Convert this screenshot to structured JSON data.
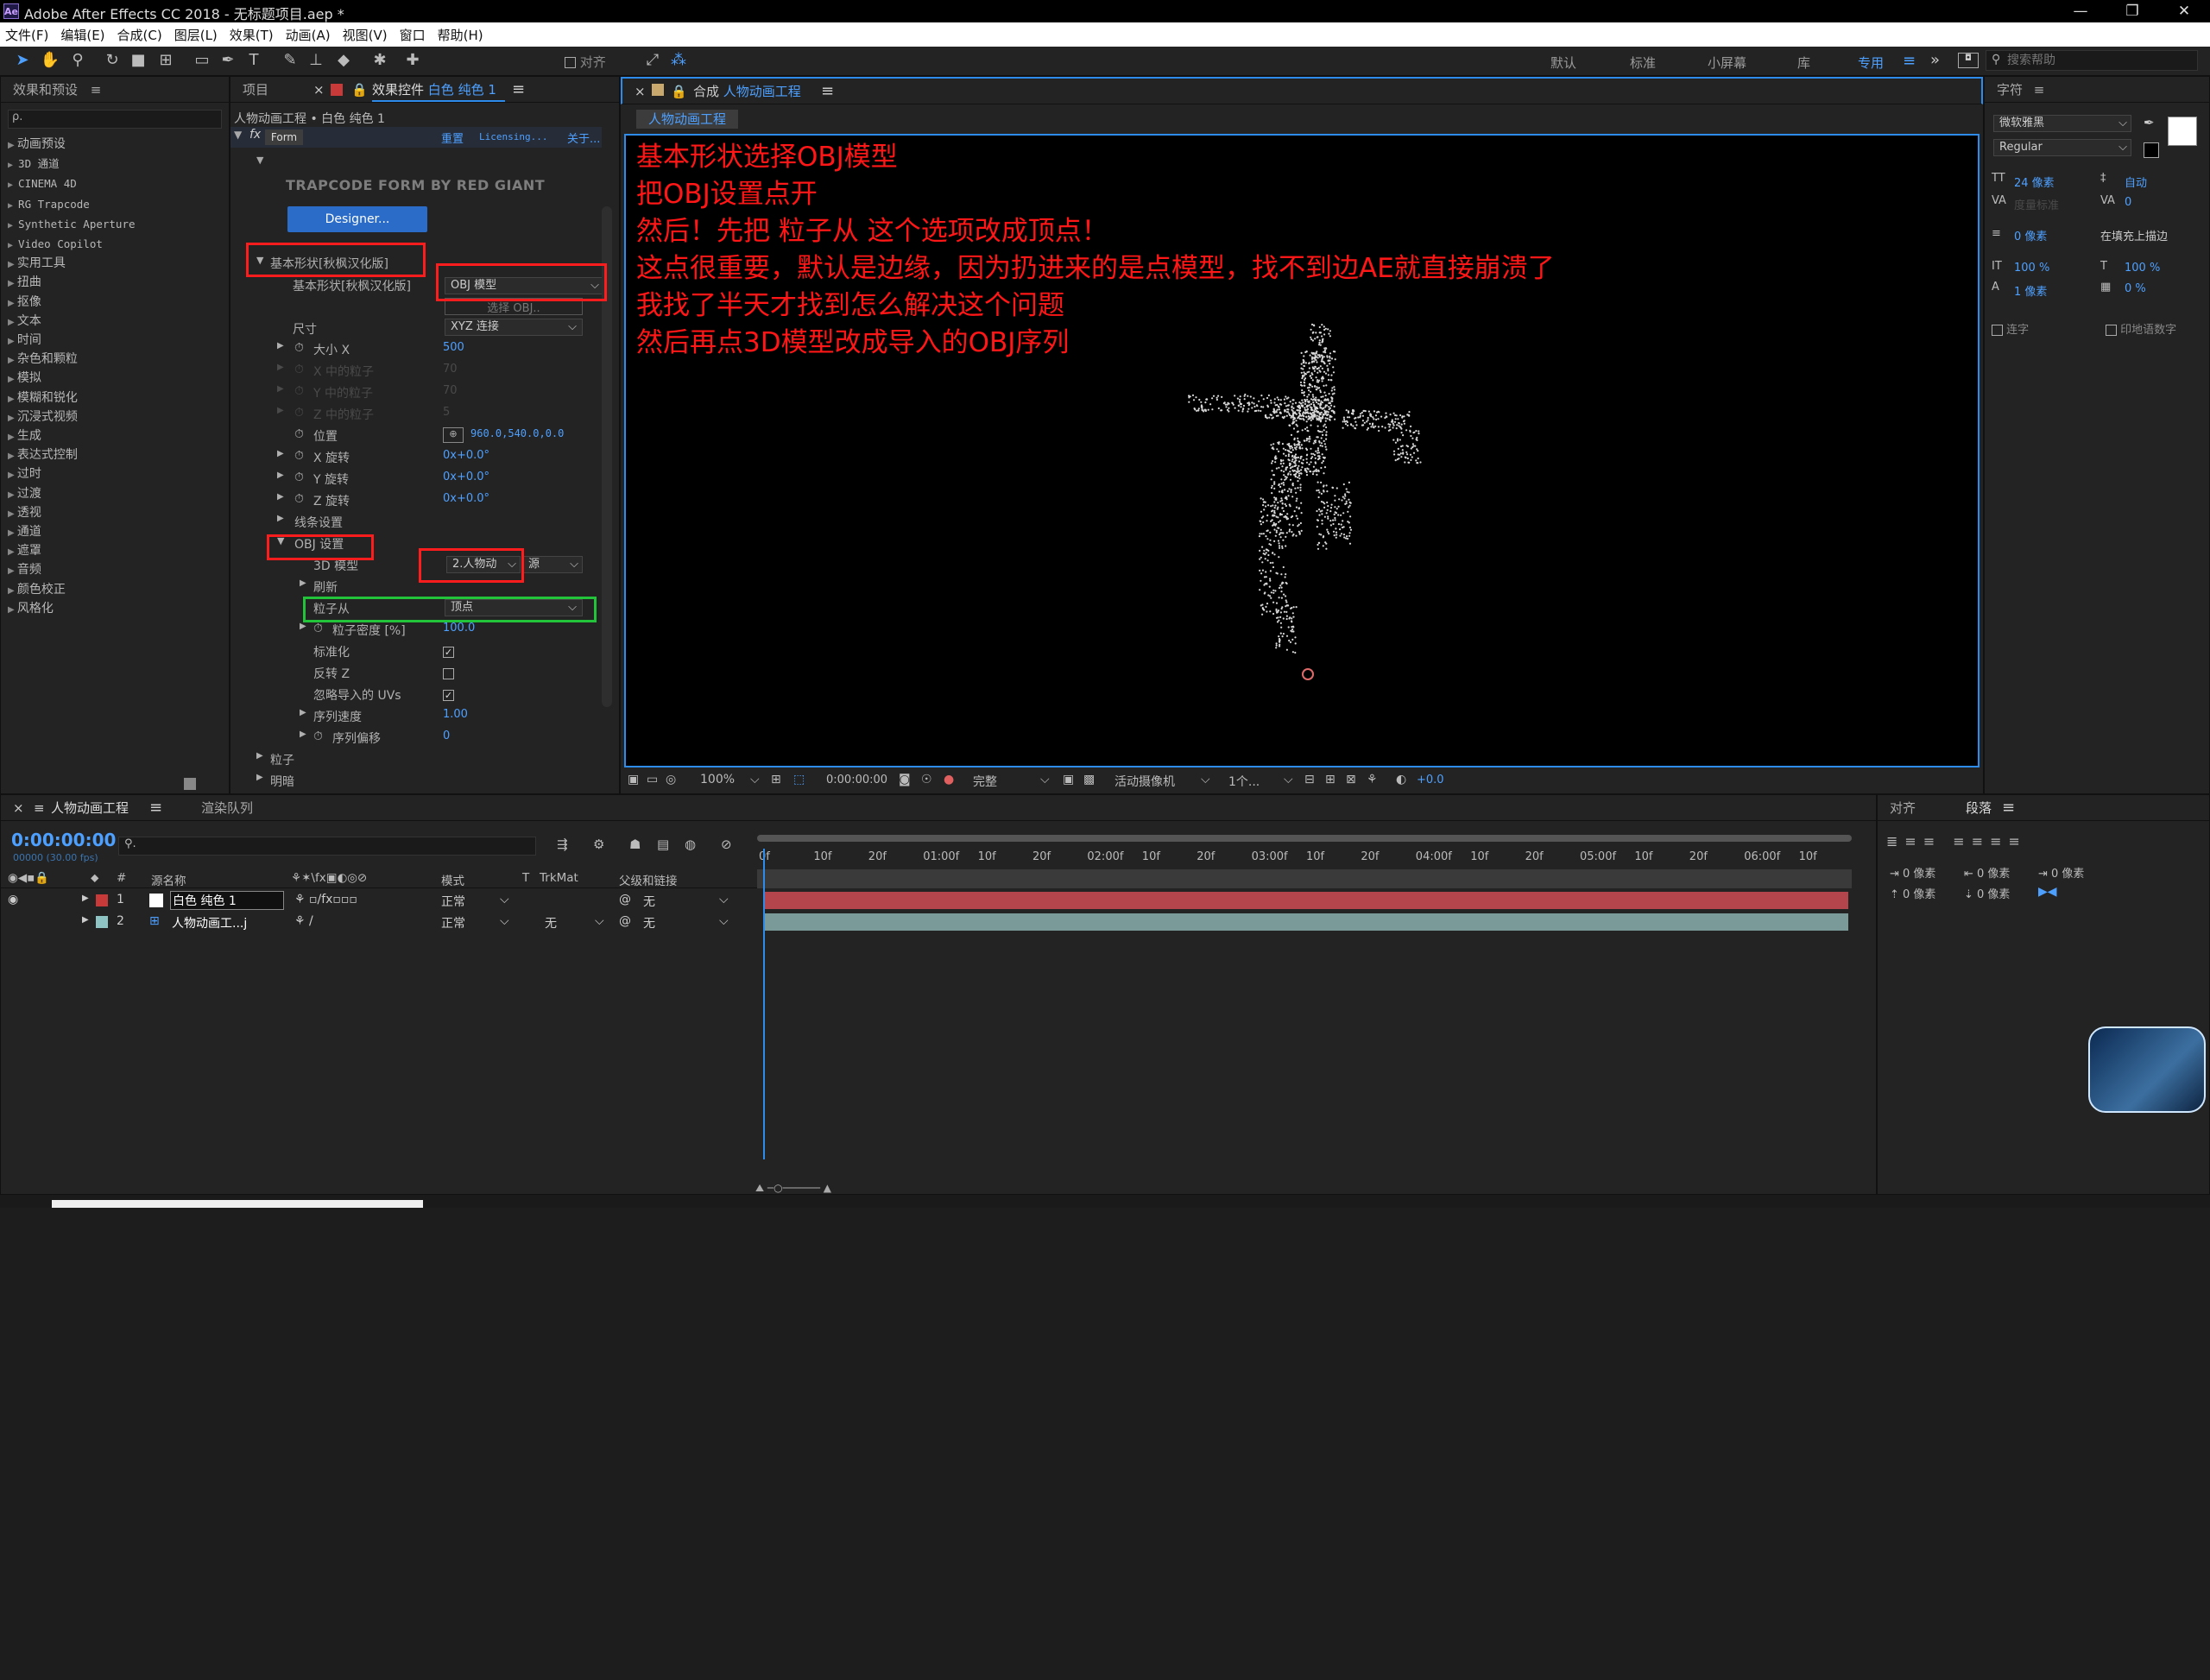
{
  "app": {
    "title": "Adobe After Effects CC 2018 - 无标题项目.aep *",
    "icon": "Ae"
  },
  "menu": [
    "文件(F)",
    "编辑(E)",
    "合成(C)",
    "图层(L)",
    "效果(T)",
    "动画(A)",
    "视图(V)",
    "窗口",
    "帮助(H)"
  ],
  "toolbar": {
    "align_label": "对齐",
    "workspaces": [
      "默认",
      "标准",
      "小屏幕",
      "库",
      "专用"
    ],
    "search_placeholder": "搜索帮助"
  },
  "effects_panel": {
    "title": "效果和预设",
    "search": "ρ.",
    "items": [
      "动画预设",
      "3D 通道",
      "CINEMA 4D",
      "RG Trapcode",
      "Synthetic Aperture",
      "Video Copilot",
      "实用工具",
      "扭曲",
      "抠像",
      "文本",
      "时间",
      "杂色和颗粒",
      "模拟",
      "模糊和锐化",
      "沉浸式视频",
      "生成",
      "表达式控制",
      "过时",
      "过渡",
      "透视",
      "通道",
      "遮罩",
      "音频",
      "颜色校正",
      "风格化"
    ]
  },
  "effect_controls": {
    "tab_project": "项目",
    "tab_effect": "效果控件",
    "layer_name": "白色 纯色 1",
    "breadcrumb": "人物动画工程 • 白色 纯色 1",
    "fx_name": "Form",
    "reset": "重置",
    "licensing": "Licensing...",
    "about": "关于...",
    "brand": "TRAPCODE FORM BY RED GIANT",
    "designer": "Designer...",
    "base_form_group": "基本形状[秋枫汉化版]",
    "base_form_label": "基本形状[秋枫汉化版]",
    "base_form_value": "OBJ 模型",
    "select_obj": "选择 OBJ..",
    "size_label": "尺寸",
    "size_value": "XYZ 连接",
    "rows": [
      {
        "label": "大小 X",
        "value": "500",
        "dim": false
      },
      {
        "label": "X 中的粒子",
        "value": "70",
        "dim": true
      },
      {
        "label": "Y 中的粒子",
        "value": "70",
        "dim": true
      },
      {
        "label": "Z 中的粒子",
        "value": "5",
        "dim": true
      }
    ],
    "position_label": "位置",
    "position_value": "960.0,540.0,0.0",
    "rot_x": "X 旋转",
    "rot_y": "Y 旋转",
    "rot_z": "Z 旋转",
    "rot_value": "0x+0.0°",
    "string_settings": "线条设置",
    "obj_settings": "OBJ 设置",
    "model_label": "3D 模型",
    "model_value": "2.人物动",
    "source_value": "源",
    "refresh": "刷新",
    "particles_from": "粒子从",
    "particles_from_value": "顶点",
    "density_label": "粒子密度 [%]",
    "density_value": "100.0",
    "normalize": "标准化",
    "invert_z": "反转 Z",
    "ignore_uvs": "忽略导入的 UVs",
    "seq_speed": "序列速度",
    "seq_speed_value": "1.00",
    "seq_offset": "序列偏移",
    "seq_offset_value": "0",
    "particle": "粒子",
    "shading": "明暗"
  },
  "viewer": {
    "tab_prefix": "合成",
    "comp_name": "人物动画工程",
    "sub_tab": "人物动画工程",
    "annotations": [
      "基本形状选择OBJ模型",
      "把OBJ设置点开",
      "然后！先把  粒子从  这个选项改成顶点！",
      "这点很重要，默认是边缘，因为扔进来的是点模型，找不到边AE就直接崩溃了",
      "我找了半天才找到怎么解决这个问题",
      "然后再点3D模型改成导入的OBJ序列"
    ],
    "zoom": "100%",
    "time": "0:00:00:00",
    "quality": "完整",
    "camera": "活动摄像机",
    "views": "1个...",
    "exposure": "+0.0"
  },
  "character_panel": {
    "title": "字符",
    "font": "微软雅黑",
    "style": "Regular",
    "size": "24 像素",
    "leading": "自动",
    "kerning": "度量标准",
    "tracking": "0",
    "stroke": "0 像素",
    "stroke_mode": "在填充上描边",
    "vscale": "100 %",
    "hscale": "100 %",
    "baseline": "1 像素",
    "tsume": "0 %",
    "ligature": "连字",
    "hindi": "印地语数字"
  },
  "timeline": {
    "tab": "人物动画工程",
    "render_tab": "渲染队列",
    "time": "0:00:00:00",
    "fps": "00000 (30.00 fps)",
    "col_source": "源名称",
    "col_mode": "模式",
    "col_trk": "TrkMat",
    "col_parent": "父级和链接",
    "layers": [
      {
        "num": "1",
        "name": "白色 纯色 1",
        "mode": "正常",
        "trk": "",
        "parent": "无",
        "color": "#c83a3a"
      },
      {
        "num": "2",
        "name": "人物动画工...j",
        "mode": "正常",
        "trk": "无",
        "parent": "无",
        "color": "#8fc4c4"
      }
    ],
    "ruler": [
      "0f",
      "10f",
      "20f",
      "01:00f",
      "10f",
      "20f",
      "02:00f",
      "10f",
      "20f",
      "03:00f",
      "10f",
      "20f",
      "04:00f",
      "10f",
      "20f",
      "05:00f",
      "10f",
      "20f",
      "06:00f",
      "10f"
    ]
  },
  "paragraph_panel": {
    "tab_align": "对齐",
    "tab_para": "段落",
    "values": [
      "0 像素",
      "0 像素",
      "0 像素",
      "0 像素",
      "0 像素"
    ]
  },
  "colors": {
    "accent": "#2d8ceb",
    "red_box": "#ff1c1c",
    "green_box": "#22c43a",
    "layer_bar1": "#b5454d",
    "layer_bar2": "#7a9a9a"
  }
}
